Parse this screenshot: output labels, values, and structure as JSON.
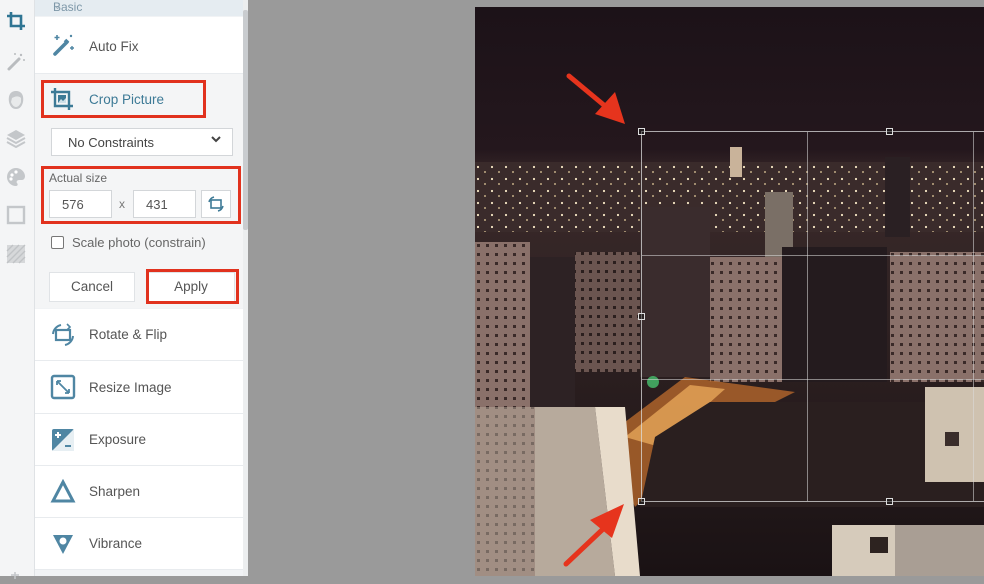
{
  "toolrail": {
    "items": [
      {
        "name": "crop-tool",
        "icon": "crop-icon",
        "active": true
      },
      {
        "name": "effects-tool",
        "icon": "magic-wand-icon",
        "active": false
      },
      {
        "name": "retouch-tool",
        "icon": "face-icon",
        "active": false
      },
      {
        "name": "layers-tool",
        "icon": "layers-icon",
        "active": false
      },
      {
        "name": "paint-tool",
        "icon": "palette-icon",
        "active": false
      },
      {
        "name": "frames-tool",
        "icon": "frame-icon",
        "active": false
      },
      {
        "name": "textures-tool",
        "icon": "texture-icon",
        "active": false
      }
    ]
  },
  "panel": {
    "section_title": "Basic",
    "auto_fix_label": "Auto Fix",
    "crop_label": "Crop Picture",
    "constraint_select": "No Constraints",
    "actual_size_label": "Actual size",
    "width_value": "576",
    "height_value": "431",
    "times_sep": "x",
    "scale_label": "Scale photo (constrain)",
    "scale_checked": false,
    "cancel_label": "Cancel",
    "apply_label": "Apply",
    "tools": [
      {
        "label": "Rotate & Flip",
        "icon": "rotate-icon"
      },
      {
        "label": "Resize Image",
        "icon": "resize-icon"
      },
      {
        "label": "Exposure",
        "icon": "exposure-icon"
      },
      {
        "label": "Sharpen",
        "icon": "sharpen-icon"
      },
      {
        "label": "Vibrance",
        "icon": "vibrance-icon"
      }
    ]
  },
  "colors": {
    "accent": "#3d7a96",
    "highlight": "#e1321e",
    "canvas_bg": "#9a9a9a"
  },
  "canvas": {
    "image_description": "night city skyline photo",
    "crop_handles": 6
  }
}
